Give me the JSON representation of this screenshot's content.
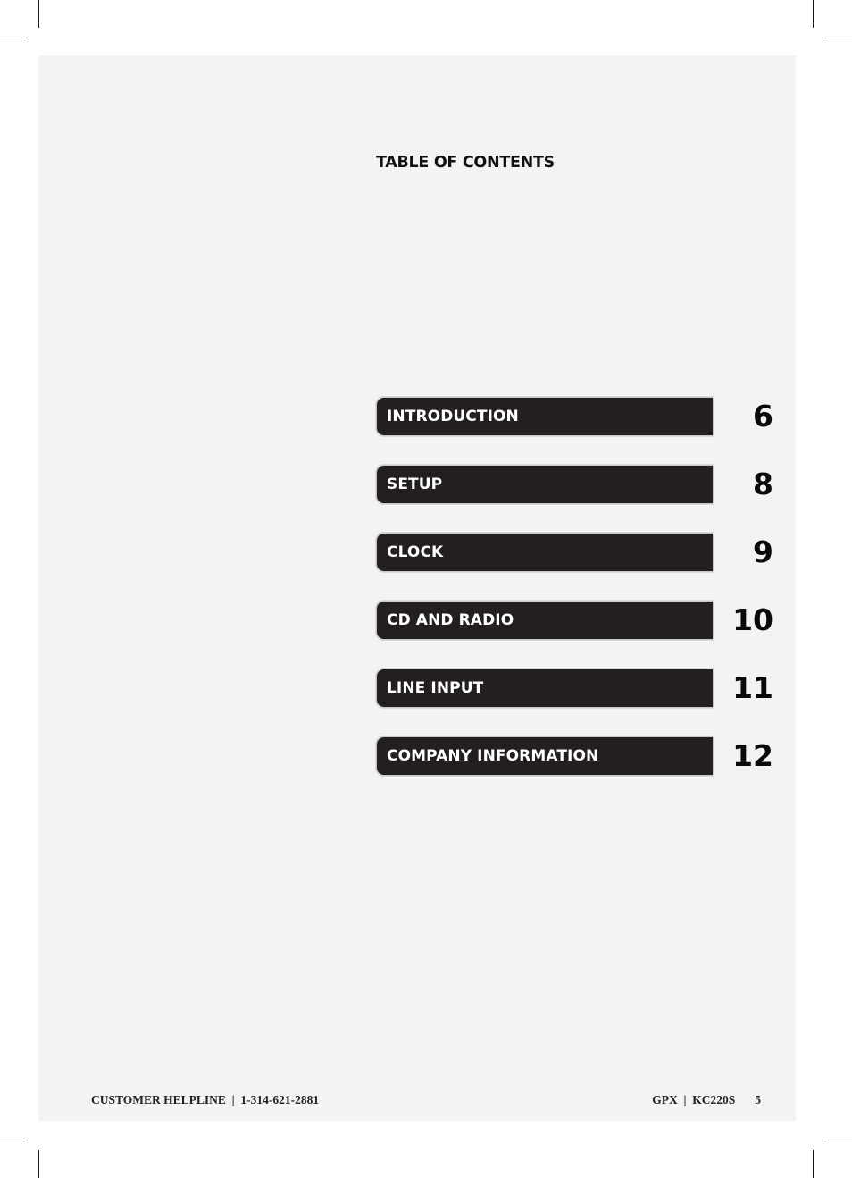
{
  "header": {
    "title": "TABLE OF CONTENTS"
  },
  "toc": {
    "entries": [
      {
        "label": "INTRODUCTION",
        "page": "6"
      },
      {
        "label": "SETUP",
        "page": "8"
      },
      {
        "label": "CLOCK",
        "page": "9"
      },
      {
        "label": "CD AND RADIO",
        "page": "10"
      },
      {
        "label": "LINE INPUT",
        "page": "11"
      },
      {
        "label": "COMPANY INFORMATION",
        "page": "12"
      }
    ]
  },
  "footer": {
    "helpline": "CUSTOMER HELPLINE  |  1-314-621-2881",
    "product": "GPX  |  KC220S",
    "page_number": "5"
  },
  "colors": {
    "page_background": "#f3f3f3",
    "bar_fill": "#231f20",
    "bar_text": "#ffffff"
  }
}
